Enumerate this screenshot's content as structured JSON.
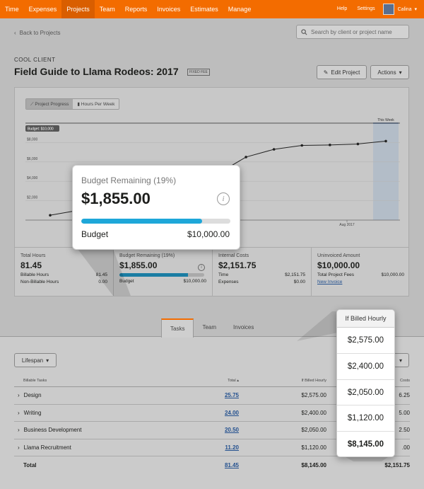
{
  "nav": {
    "items": [
      "Time",
      "Expenses",
      "Projects",
      "Team",
      "Reports",
      "Invoices",
      "Estimates",
      "Manage"
    ],
    "active": 2,
    "help": "Help",
    "settings": "Settings",
    "user": "Calina"
  },
  "back": "Back to Projects",
  "search": {
    "placeholder": "Search by client or project name"
  },
  "project": {
    "client": "COOL CLIENT",
    "title": "Field Guide to Llama Rodeos: 2017",
    "fee": "FIXED FEE"
  },
  "buttons": {
    "edit": "Edit Project",
    "actions": "Actions"
  },
  "chart_toggle": {
    "progress": "Project Progress",
    "hours": "Hours Per Week"
  },
  "chart_data": {
    "type": "line",
    "budget_label": "Budget: $10,000",
    "this_week": "This Week",
    "y_ticks": [
      "$8,000",
      "$6,000",
      "$4,000",
      "$2,000"
    ],
    "x_tick": "Aug 2017",
    "ylim": [
      0,
      10000
    ],
    "budget": 10000,
    "values": [
      500,
      1000,
      1800,
      2500,
      3100,
      3700,
      4800,
      6500,
      7300,
      7700,
      7750,
      7850,
      8145
    ]
  },
  "stats": {
    "hours": {
      "label": "Total Hours",
      "value": "81.45",
      "r1l": "Billable Hours",
      "r1v": "81.45",
      "r2l": "Non-Billable Hours",
      "r2v": "0.00"
    },
    "budget": {
      "label": "Budget Remaining (19%)",
      "value": "$1,855.00",
      "r1l": "Budget",
      "r1v": "$10,000.00",
      "progress": 0.81
    },
    "costs": {
      "label": "Internal Costs",
      "value": "$2,151.75",
      "r1l": "Time",
      "r1v": "$2,151.75",
      "r2l": "Expenses",
      "r2v": "$0.00"
    },
    "uninvoiced": {
      "label": "Uninvoiced Amount",
      "value": "$10,000.00",
      "r1l": "Total Project Fees",
      "r1v": "$10,000.00",
      "link": "New Invoice"
    }
  },
  "popup": {
    "label": "Budget Remaining (19%)",
    "value": "$1,855.00",
    "budget_label": "Budget",
    "budget_value": "$10,000.00",
    "progress": 0.81
  },
  "tabs": [
    "Tasks",
    "Team",
    "Invoices"
  ],
  "lifespan": "Lifespan",
  "table": {
    "headers": [
      "Billable Tasks",
      "Total",
      "If Billed Hourly",
      "Costs"
    ],
    "rows": [
      {
        "name": "Design",
        "total": "25.75",
        "hourly": "$2,575.00",
        "cost": "6.25"
      },
      {
        "name": "Writing",
        "total": "24.00",
        "hourly": "$2,400.00",
        "cost": "5.00"
      },
      {
        "name": "Business Development",
        "total": "20.50",
        "hourly": "$2,050.00",
        "cost": "2.50"
      },
      {
        "name": "Llama Recruitment",
        "total": "11.20",
        "hourly": "$1,120.00",
        "cost": ".00"
      }
    ],
    "total": {
      "name": "Total",
      "total": "81.45",
      "hourly": "$8,145.00",
      "cost": "$2,151.75"
    }
  },
  "billed_popup": {
    "title": "If Billed Hourly",
    "values": [
      "$2,575.00",
      "$2,400.00",
      "$2,050.00",
      "$1,120.00",
      "$8,145.00"
    ]
  },
  "colors": {
    "accent": "#f36c00",
    "progress": "#1ea7d9",
    "link": "#24518f"
  }
}
